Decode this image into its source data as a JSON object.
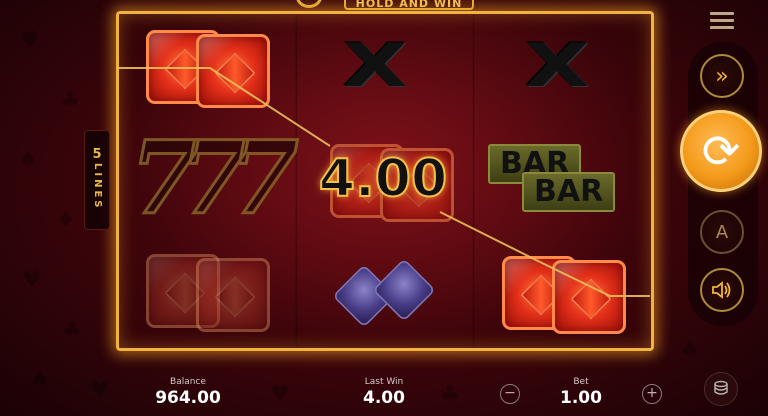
{
  "game": {
    "banner_text": "HOLD AND WIN",
    "lines_count": "5",
    "lines_word": "LINES"
  },
  "reels": {
    "symbols": [
      [
        "red-gem-pair",
        "seven-seven-seven",
        "red-gem-pair"
      ],
      [
        "x-symbol",
        "red-gem-pair",
        "purple-gem-pair"
      ],
      [
        "x-symbol",
        "bar-bar",
        "red-gem-pair"
      ]
    ],
    "seven_text": "777",
    "x_text": "X",
    "bar_top": "BAR",
    "bar_bottom": "BAR",
    "win_amount": "4.00"
  },
  "controls": {
    "turbo_icon": "fast-forward-icon",
    "spin_icon": "spin-arrows-icon",
    "auto_label": "A",
    "sound_icon": "speaker-icon",
    "menu_icon": "hamburger-icon"
  },
  "footer": {
    "balance_label": "Balance",
    "balance_value": "964.00",
    "last_win_label": "Last Win",
    "last_win_value": "4.00",
    "bet_label": "Bet",
    "bet_value": "1.00",
    "bet_minus": "−",
    "bet_plus": "+"
  },
  "colors": {
    "frame_gold": "#f2b33d",
    "background_red": "#6e0c14",
    "spin_orange": "#f49a1a"
  }
}
